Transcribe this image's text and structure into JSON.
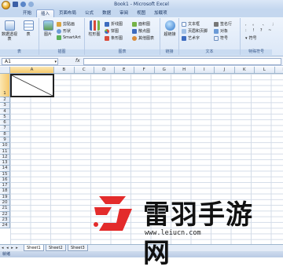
{
  "window": {
    "title": "Book1 - Microsoft Excel"
  },
  "tabs": [
    "开始",
    "插入",
    "页面布局",
    "公式",
    "数据",
    "审阅",
    "视图",
    "加载项"
  ],
  "active_tab": "插入",
  "ribbon": {
    "tables_group": {
      "label": "表",
      "items": [
        "数据透视表",
        "表"
      ]
    },
    "illustrations_group": {
      "label": "插图",
      "items": [
        "图片",
        "剪贴画",
        "形状",
        "SmartArt"
      ]
    },
    "charts_group": {
      "label": "图表",
      "big": "柱形图",
      "items": [
        "折线图",
        "饼图",
        "条形图",
        "面积图",
        "散点图",
        "其他图表"
      ]
    },
    "links_group": {
      "label": "链接",
      "items": [
        "超链接"
      ]
    },
    "text_group": {
      "label": "文本",
      "items": [
        "文本框",
        "页眉和页脚",
        "艺术字",
        "签名行",
        "对象",
        "符号"
      ]
    },
    "special_group": {
      "label": "特殊符号",
      "items": [
        "符号"
      ]
    }
  },
  "formula_bar": {
    "name_box": "A1",
    "fx": "fx",
    "formula": ""
  },
  "columns": [
    "A",
    "B",
    "C",
    "D",
    "E",
    "F",
    "G",
    "H",
    "I",
    "J",
    "K",
    "L",
    "M",
    "N"
  ],
  "rows": [
    "1",
    "2",
    "3",
    "4",
    "5",
    "6",
    "7",
    "8",
    "9",
    "10",
    "11",
    "12",
    "13",
    "14",
    "15",
    "16",
    "17",
    "18",
    "19",
    "20",
    "21",
    "22",
    "23",
    "24"
  ],
  "sheets": [
    "Sheet1",
    "Sheet2",
    "Sheet3"
  ],
  "active_sheet": "Sheet1",
  "status": "就绪",
  "watermark": {
    "text": "雷羽手游网",
    "url": "www.leiucn.com"
  },
  "colors": {
    "ribbon_bg": "#dbe7f7",
    "selected_header": "#f6c86a",
    "watermark_red": "#e32b2b"
  }
}
